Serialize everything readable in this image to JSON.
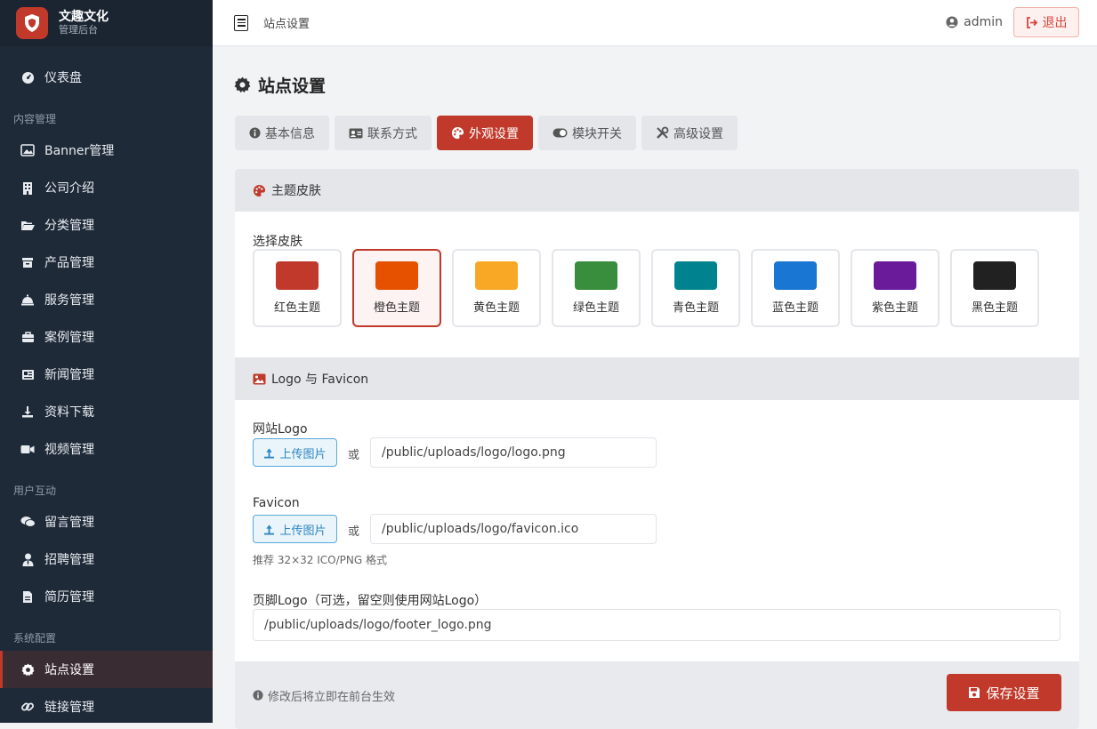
{
  "sidebar": {
    "brand_title": "文趣文化",
    "brand_sub": "管理后台",
    "dashboard": "仪表盘",
    "group_content": "内容管理",
    "banner": "Banner管理",
    "company": "公司介绍",
    "category": "分类管理",
    "product": "产品管理",
    "service": "服务管理",
    "case": "案例管理",
    "news": "新闻管理",
    "download": "资料下载",
    "video": "视频管理",
    "group_interaction": "用户互动",
    "message": "留言管理",
    "recruit": "招聘管理",
    "resume": "简历管理",
    "group_system": "系统配置",
    "site": "站点设置",
    "link": "链接管理"
  },
  "topbar": {
    "breadcrumb": "站点设置",
    "user": "admin",
    "logout": "退出"
  },
  "page": {
    "title": "站点设置"
  },
  "tabs": {
    "basic": "基本信息",
    "contact": "联系方式",
    "appearance": "外观设置",
    "modules": "模块开关",
    "advanced": "高级设置"
  },
  "theme": {
    "section_title": "主题皮肤",
    "select_label": "选择皮肤",
    "selected": "橙色主题",
    "skins": [
      {
        "name": "红色主题",
        "color": "#c0392b"
      },
      {
        "name": "橙色主题",
        "color": "#e65100"
      },
      {
        "name": "黄色主题",
        "color": "#f9a825"
      },
      {
        "name": "绿色主题",
        "color": "#388e3c"
      },
      {
        "name": "青色主题",
        "color": "#00838f"
      },
      {
        "name": "蓝色主题",
        "color": "#1976d2"
      },
      {
        "name": "紫色主题",
        "color": "#6a1b9a"
      },
      {
        "name": "黑色主题",
        "color": "#212121"
      }
    ]
  },
  "logo": {
    "section_title": "Logo 与 Favicon",
    "site_logo_label": "网站Logo",
    "upload_label": "上传图片",
    "or": "或",
    "site_logo_value": "/public/uploads/logo/logo.png",
    "favicon_label": "Favicon",
    "favicon_value": "/public/uploads/logo/favicon.ico",
    "favicon_hint": "推荐 32×32 ICO/PNG 格式",
    "footer_logo_label": "页脚Logo（可选，留空则使用网站Logo）",
    "footer_logo_value": "/public/uploads/logo/footer_logo.png"
  },
  "footer": {
    "tip": "修改后将立即在前台生效",
    "save": "保存设置"
  },
  "colors": {
    "accent": "#c0392b",
    "sidebar_bg": "#1f2a38"
  }
}
